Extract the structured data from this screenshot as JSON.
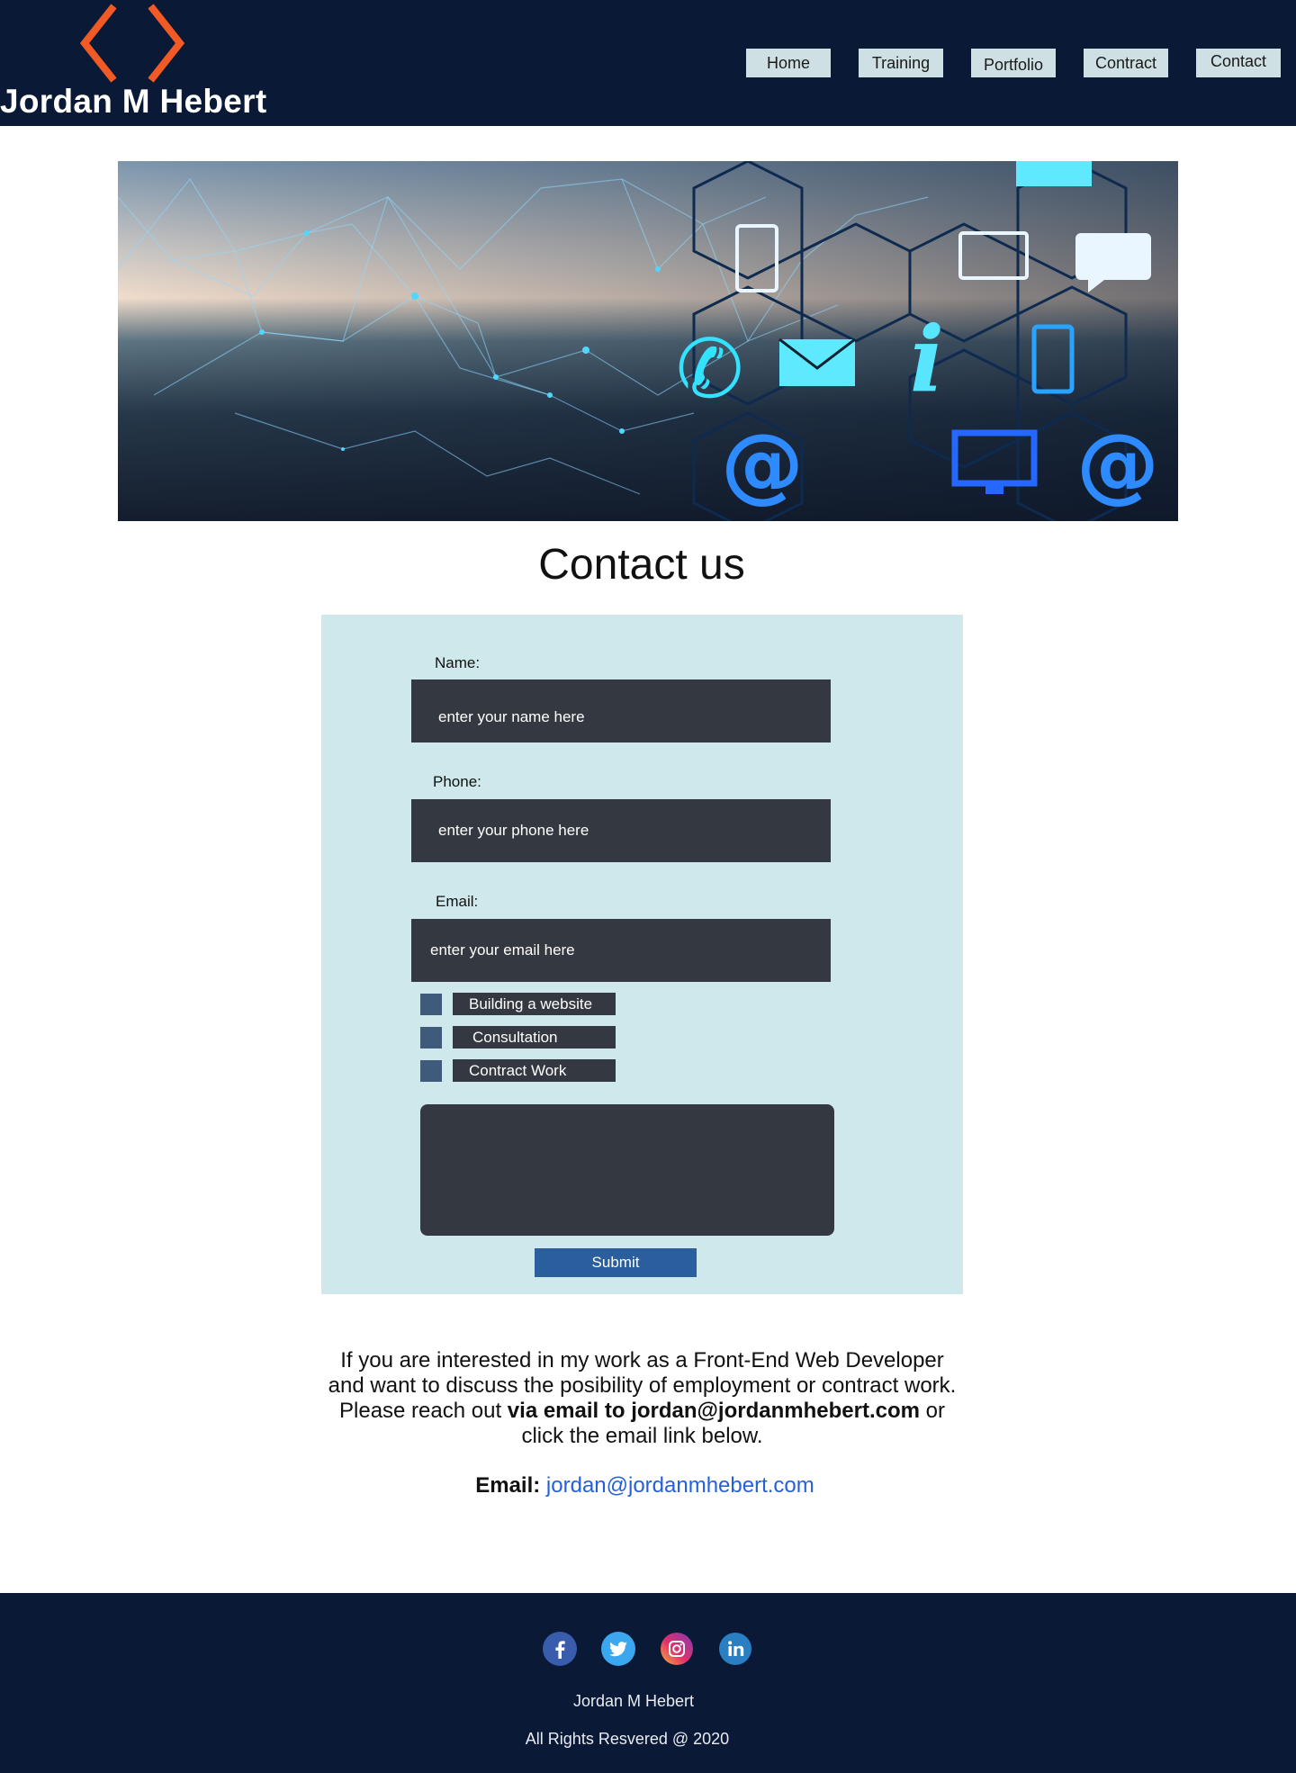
{
  "header": {
    "brand_name": "Jordan M Hebert",
    "logo_icon": "angle-brackets-icon",
    "logo_color": "#f15a24",
    "background": "#0a1936",
    "nav": [
      {
        "label": "Home"
      },
      {
        "label": "Training"
      },
      {
        "label": "Portfolio"
      },
      {
        "label": "Contract"
      },
      {
        "label": "Contact"
      }
    ]
  },
  "hero": {
    "image": "network-contact-icons-banner",
    "icons": [
      "phone-icon",
      "tablet-icon",
      "laptop-icon",
      "chat-bubble-icon",
      "envelope-icon",
      "info-icon",
      "at-sign-icon",
      "monitor-icon"
    ]
  },
  "main": {
    "title": "Contact us"
  },
  "form": {
    "name_label": "Name:",
    "name_placeholder": "enter your name here",
    "phone_label": "Phone:",
    "phone_placeholder": "enter your phone here",
    "email_label": "Email:",
    "email_placeholder": "enter your email here",
    "options": [
      {
        "label": "Building a website"
      },
      {
        "label": "Consultation"
      },
      {
        "label": "Contract Work"
      }
    ],
    "message_value": "",
    "submit_label": "Submit"
  },
  "info": {
    "line_1": "If you are interested in my work as a Front-End Web Developer and want to discuss the posibility of employment or contract work. Please reach out ",
    "bold": "via email to jordan@jordanmhebert.com",
    "line_2": " or click the email link below.",
    "email_label": "Email:",
    "email_link": "jordan@jordanmhebert.com"
  },
  "footer": {
    "social": [
      {
        "icon": "facebook-icon"
      },
      {
        "icon": "twitter-icon"
      },
      {
        "icon": "instagram-icon"
      },
      {
        "icon": "linkedin-icon"
      }
    ],
    "name": "Jordan M Hebert",
    "copyright": "All Rights Resvered @ 2020"
  }
}
